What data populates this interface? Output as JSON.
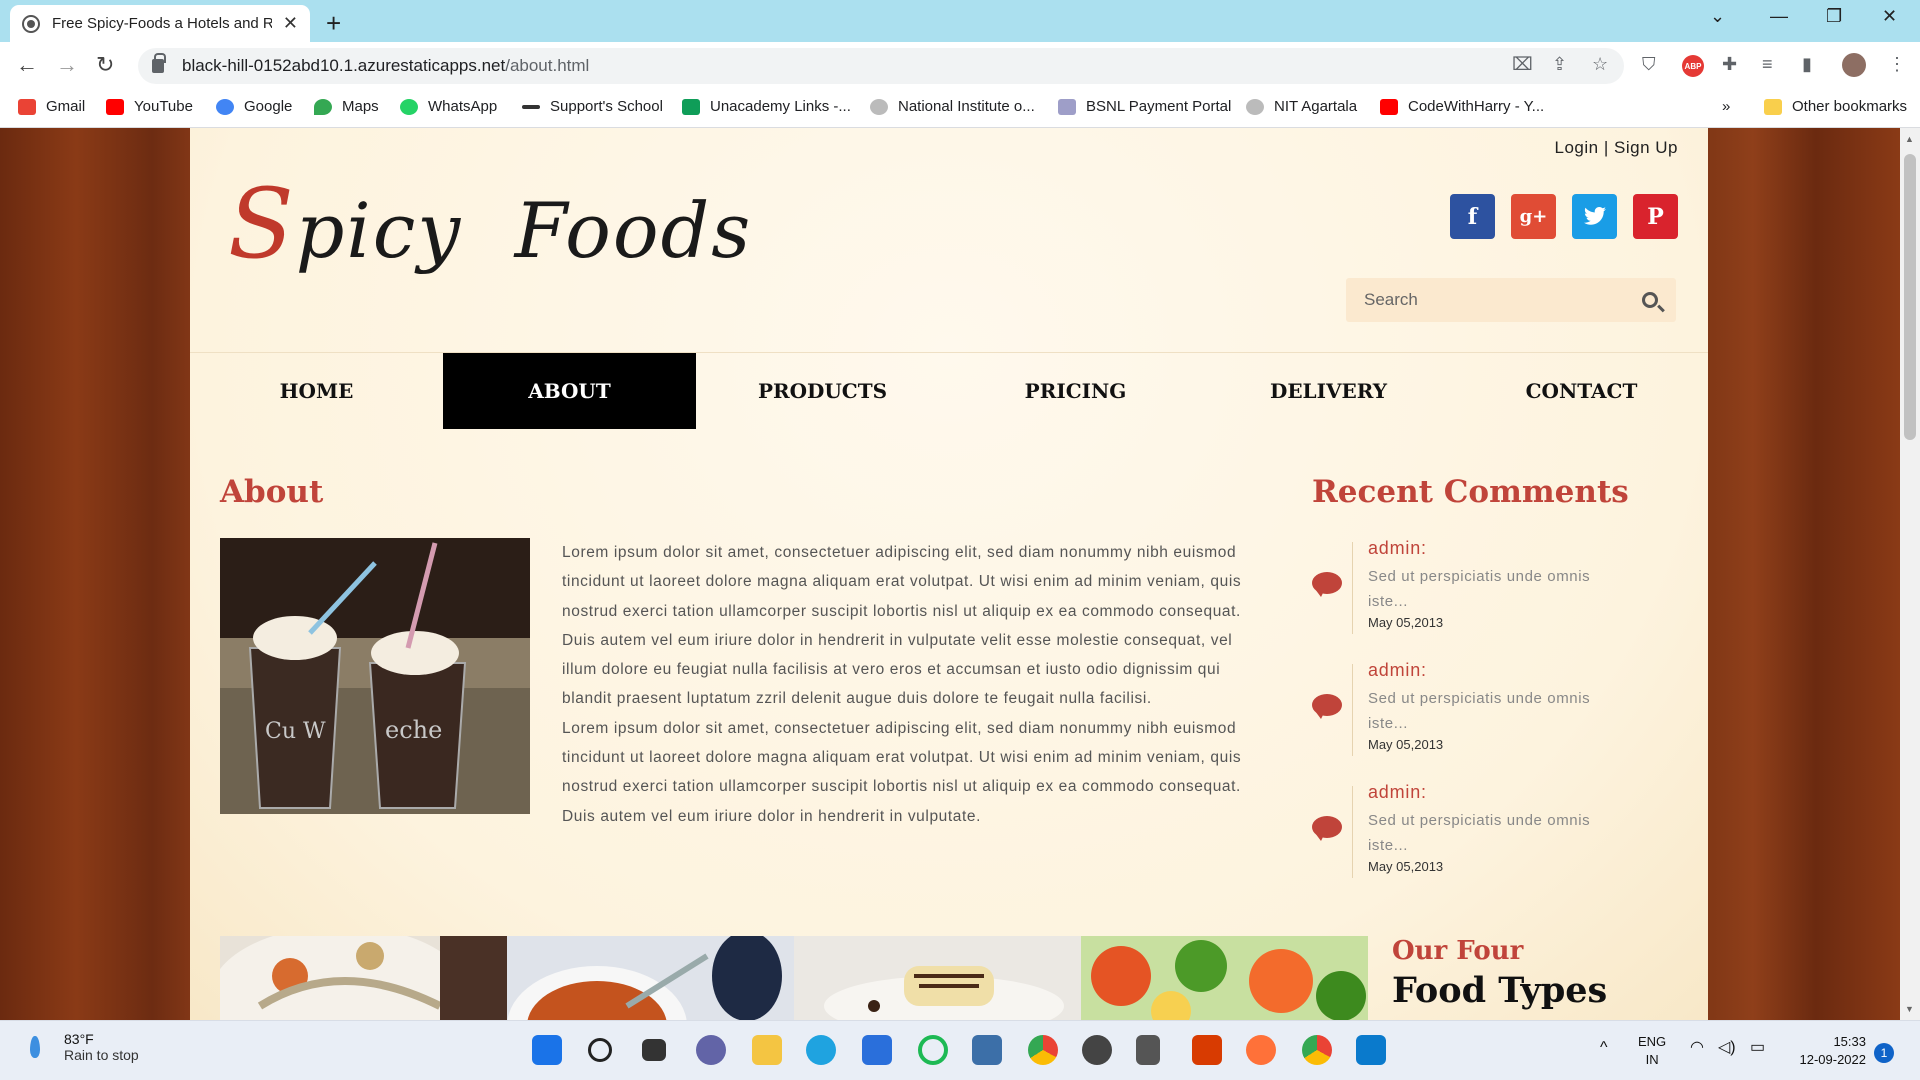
{
  "browser": {
    "tab_title": "Free Spicy-Foods a Hotels and Re",
    "url_host": "black-hill-0152abd10.1.azurestaticapps.net",
    "url_path": "/about.html",
    "bookmarks": [
      "Gmail",
      "YouTube",
      "Google",
      "Maps",
      "WhatsApp",
      "Support's School",
      "Unacademy Links -...",
      "National Institute o...",
      "BSNL Payment Portal",
      "NIT Agartala",
      "CodeWithHarry - Y..."
    ],
    "other_bookmarks": "Other bookmarks",
    "abp_label": "ABP"
  },
  "site": {
    "login": "Login",
    "separator": "|",
    "signup": "Sign Up",
    "logo_first": "S",
    "logo_rest1": "picy",
    "logo_second": "Foods",
    "social": [
      {
        "name": "facebook",
        "glyph": "f",
        "color": "#2d52a0"
      },
      {
        "name": "google-plus",
        "glyph": "g+",
        "color": "#e04c35"
      },
      {
        "name": "twitter",
        "glyph": "t",
        "color": "#1a9de6"
      },
      {
        "name": "pinterest",
        "glyph": "P",
        "color": "#d9232d"
      }
    ],
    "search_placeholder": "Search"
  },
  "nav": {
    "items": [
      "HOME",
      "ABOUT",
      "PRODUCTS",
      "PRICING",
      "DELIVERY",
      "CONTACT"
    ],
    "active": "ABOUT"
  },
  "about": {
    "heading": "About",
    "paragraph1": "Lorem ipsum dolor sit amet, consectetuer adipiscing elit, sed diam nonummy nibh euismod tincidunt ut laoreet dolore magna aliquam erat volutpat. Ut wisi enim ad minim veniam, quis nostrud exerci tation ullamcorper suscipit lobortis nisl ut aliquip ex ea commodo consequat. Duis autem vel eum iriure dolor in hendrerit in vulputate velit esse molestie consequat, vel illum dolore eu feugiat nulla facilisis at vero eros et accumsan et iusto odio dignissim qui blandit praesent luptatum zzril delenit augue duis dolore te feugait nulla facilisi.",
    "paragraph2": "Lorem ipsum dolor sit amet, consectetuer adipiscing elit, sed diam nonummy nibh euismod tincidunt ut laoreet dolore magna aliquam erat volutpat. Ut wisi enim ad minim veniam, quis nostrud exerci tation ullamcorper suscipit lobortis nisl ut aliquip ex ea commodo consequat. Duis autem vel eum iriure dolor in hendrerit in vulputate."
  },
  "recent": {
    "heading": "Recent Comments",
    "comments": [
      {
        "author": "admin:",
        "text": "Sed ut perspiciatis unde omnis iste...",
        "date": "May 05,2013"
      },
      {
        "author": "admin:",
        "text": "Sed ut perspiciatis unde omnis iste...",
        "date": "May 05,2013"
      },
      {
        "author": "admin:",
        "text": "Sed ut perspiciatis unde omnis iste...",
        "date": "May 05,2013"
      }
    ]
  },
  "food_types": {
    "line1": "Our Four",
    "line2": "Food Types"
  },
  "taskbar": {
    "temp": "83°F",
    "weather": "Rain to stop",
    "lang1": "ENG",
    "lang2": "IN",
    "time": "15:33",
    "date": "12-09-2022",
    "notifications": "1"
  }
}
